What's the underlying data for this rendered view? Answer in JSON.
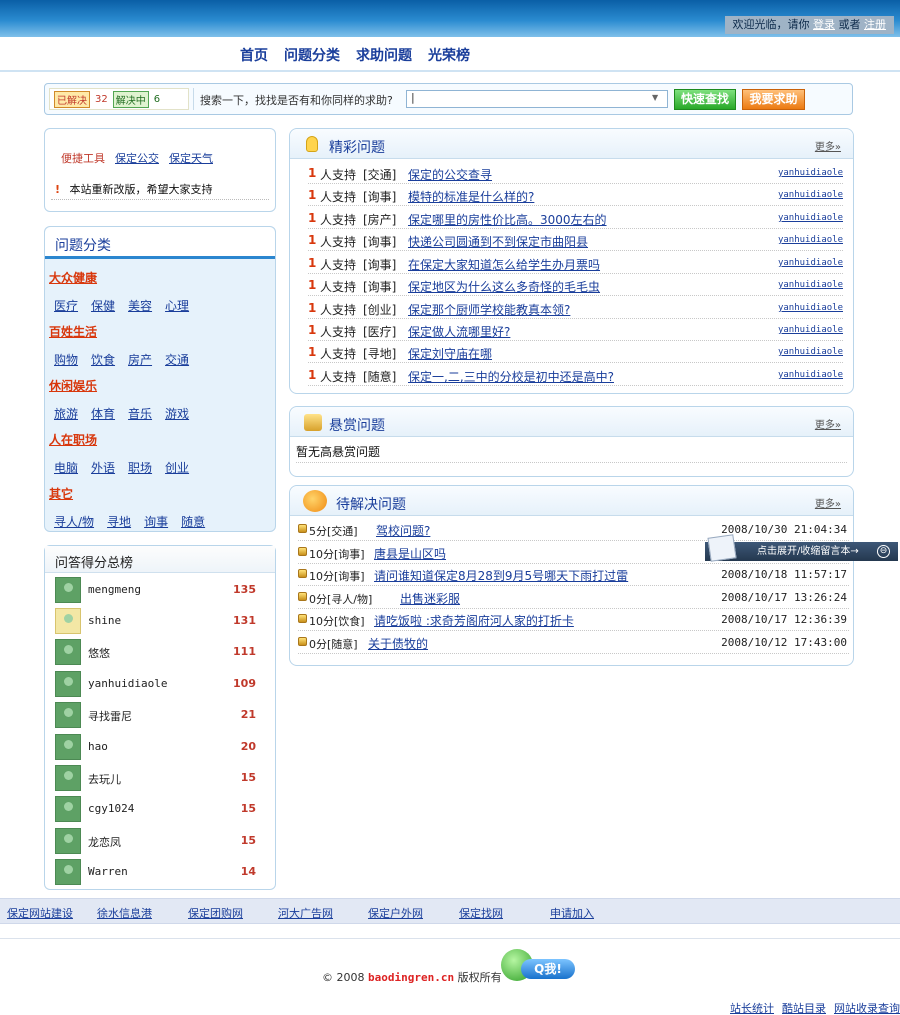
{
  "header": {
    "welcome_text": "欢迎光临，请你",
    "login_label": "登录",
    "or_text": "或者",
    "register_label": "注册"
  },
  "nav": [
    {
      "label": "首页"
    },
    {
      "label": "问题分类"
    },
    {
      "label": "求助问题"
    },
    {
      "label": "光荣榜"
    }
  ],
  "search": {
    "unsolved_label": "已解决",
    "unsolved_count": "32",
    "solving_label": "解决中",
    "solving_count": "6",
    "prompt": "搜索一下，找找是否有和你同样的求助?",
    "input_value": "|",
    "quick_find_label": "快速查找",
    "ask_label": "我要求助"
  },
  "tools": {
    "title": "便捷工具",
    "link1": "保定公交",
    "link2": "保定天气",
    "notice": "本站重新改版，希望大家支持"
  },
  "categories": {
    "title": "问题分类",
    "groups": [
      {
        "name": "大众健康",
        "items": [
          "医疗",
          "保健",
          "美容",
          "心理"
        ]
      },
      {
        "name": "百姓生活",
        "items": [
          "购物",
          "饮食",
          "房产",
          "交通"
        ]
      },
      {
        "name": "休闲娱乐",
        "items": [
          "旅游",
          "体育",
          "音乐",
          "游戏"
        ]
      },
      {
        "name": "人在职场",
        "items": [
          "电脑",
          "外语",
          "职场",
          "创业"
        ]
      },
      {
        "name": "其它",
        "items": [
          "寻人/物",
          "寻地",
          "询事",
          "随意"
        ]
      }
    ]
  },
  "ranking": {
    "title": "问答得分总榜",
    "rows": [
      {
        "name": "mengmeng",
        "score": "135"
      },
      {
        "name": "shine",
        "score": "131"
      },
      {
        "name": "悠悠",
        "score": "111"
      },
      {
        "name": "yanhuidiaole",
        "score": "109"
      },
      {
        "name": "寻找雷尼",
        "score": "21"
      },
      {
        "name": "hao",
        "score": "20"
      },
      {
        "name": "去玩儿",
        "score": "15"
      },
      {
        "name": "cgy1024",
        "score": "15"
      },
      {
        "name": "龙恋凤",
        "score": "15"
      },
      {
        "name": "Warren",
        "score": "14"
      }
    ]
  },
  "featured": {
    "title": "精彩问题",
    "more_label": "更多»",
    "support_text": "人支持",
    "rows": [
      {
        "num": "1",
        "cat": "[交通]",
        "title": "保定的公交查寻",
        "user": "yanhuidiaole"
      },
      {
        "num": "1",
        "cat": "[询事]",
        "title": "模特的标准是什么样的?",
        "user": "yanhuidiaole"
      },
      {
        "num": "1",
        "cat": "[房产]",
        "title": "保定哪里的房性价比高。3000左右的",
        "user": "yanhuidiaole"
      },
      {
        "num": "1",
        "cat": "[询事]",
        "title": "快递公司圆通到不到保定市曲阳县",
        "user": "yanhuidiaole"
      },
      {
        "num": "1",
        "cat": "[询事]",
        "title": "在保定大家知道怎么给学生办月票吗",
        "user": "yanhuidiaole"
      },
      {
        "num": "1",
        "cat": "[询事]",
        "title": "保定地区为什么这么多奇怪的毛毛虫",
        "user": "yanhuidiaole"
      },
      {
        "num": "1",
        "cat": "[创业]",
        "title": "保定那个厨师学校能教真本领?",
        "user": "yanhuidiaole"
      },
      {
        "num": "1",
        "cat": "[医疗]",
        "title": "保定做人流哪里好?",
        "user": "yanhuidiaole"
      },
      {
        "num": "1",
        "cat": "[寻地]",
        "title": "保定刘守庙在哪",
        "user": "yanhuidiaole"
      },
      {
        "num": "1",
        "cat": "[随意]",
        "title": "保定一,二,三中的分校是初中还是高中?",
        "user": "yanhuidiaole"
      }
    ]
  },
  "reward": {
    "title": "悬赏问题",
    "more_label": "更多»",
    "empty_text": "暂无高悬赏问题"
  },
  "pending": {
    "title": "待解决问题",
    "more_label": "更多»",
    "rows": [
      {
        "points": "5分[交通]",
        "title": "驾校问题?",
        "date": "2008/10/30 21:04:34"
      },
      {
        "points": "10分[询事]",
        "title": "唐县是山区吗",
        "date": ""
      },
      {
        "points": "10分[询事]",
        "title": "请问谁知道保定8月28到9月5号哪天下雨打过雷",
        "date": "2008/10/18 11:57:17"
      },
      {
        "points": "0分[寻人/物]",
        "title": "出售迷彩服",
        "date": "2008/10/17 13:26:24"
      },
      {
        "points": "10分[饮食]",
        "title": "请吃饭啦 :求奇芳阁府河人家的打折卡",
        "date": "2008/10/17 12:36:39"
      },
      {
        "points": "0分[随意]",
        "title": "关于债牧的",
        "date": "2008/10/12 17:43:00"
      }
    ]
  },
  "float_message": {
    "label": "点击展开/收缩留言本→",
    "toggle": "⊖"
  },
  "friend_links": [
    "保定网站建设",
    "徐水信息港",
    "保定团购网",
    "河大广告网",
    "保定户外网",
    "保定找网",
    "申请加入"
  ],
  "footer": {
    "copy_prefix": "© 2008",
    "domain": "baodingren.cn",
    "copy_suffix": "版权所有",
    "qq_label": "Q我!",
    "links": [
      "站长统计",
      "酷站目录",
      "网站收录查询"
    ]
  }
}
